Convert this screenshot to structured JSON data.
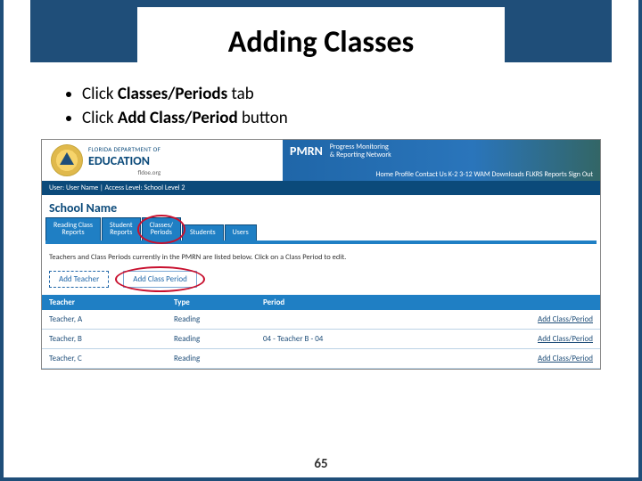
{
  "slide": {
    "title": "Adding Classes",
    "bullets": [
      {
        "prefix": "Click ",
        "bold": "Classes/Periods",
        "suffix": " tab"
      },
      {
        "prefix": "Click ",
        "bold": "Add Class/Period",
        "suffix": " button"
      }
    ],
    "page_number": "65"
  },
  "screenshot": {
    "logo": {
      "line1": "FLORIDA DEPARTMENT OF",
      "line2": "EDUCATION",
      "line3": "fldoe.org"
    },
    "pmrn": {
      "brand": "PMRN",
      "tagline1": "Progress Monitoring",
      "tagline2": "& Reporting Network",
      "nav": "Home   Profile   Contact Us   K-2   3-12 WAM   Downloads   FLKRS Reports   Sign Out"
    },
    "user_strip": "User: User Name   |   Access Level:   School Level 2",
    "school_name": "School Name",
    "tabs": [
      "Reading Class\nReports",
      "Student\nReports",
      "Classes/\nPeriods",
      "Students",
      "Users"
    ],
    "instruction": "Teachers and Class Periods currently in the PMRN are listed below. Click on a Class Period to edit.",
    "actions": {
      "add_teacher": "Add Teacher",
      "add_class_period": "Add Class Period"
    },
    "table": {
      "headers": {
        "teacher": "Teacher",
        "type": "Type",
        "period": "Period",
        "action": ""
      },
      "rows": [
        {
          "teacher": "Teacher, A",
          "type": "Reading",
          "period": "",
          "action": "Add Class/Period"
        },
        {
          "teacher": "Teacher, B",
          "type": "Reading",
          "period": "04 - Teacher B - 04",
          "action": "Add Class/Period"
        },
        {
          "teacher": "Teacher, C",
          "type": "Reading",
          "period": "",
          "action": "Add Class/Period"
        }
      ]
    }
  }
}
